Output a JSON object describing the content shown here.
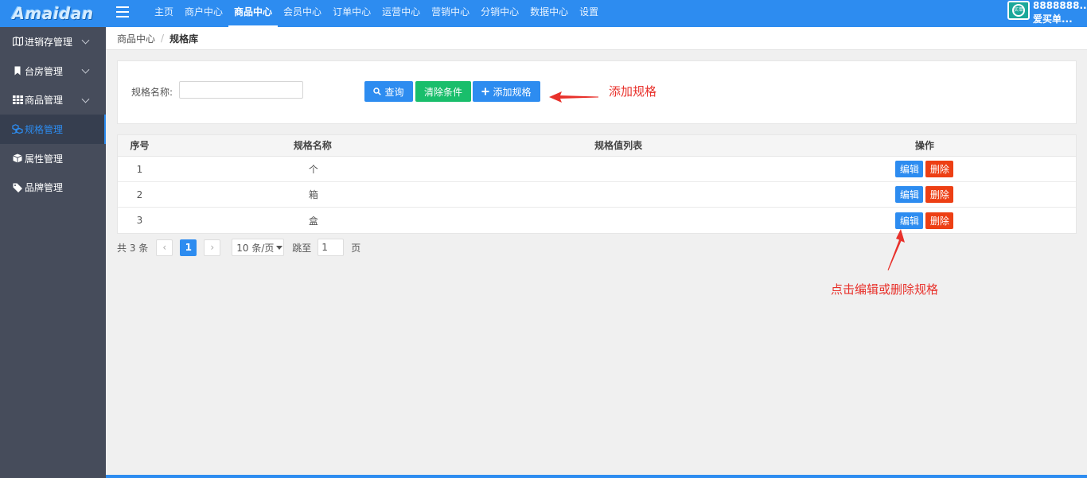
{
  "app": {
    "logo_text": "Amaidan"
  },
  "topnav": {
    "items": [
      {
        "label": "主页"
      },
      {
        "label": "商户中心"
      },
      {
        "label": "商品中心",
        "active": true
      },
      {
        "label": "会员中心"
      },
      {
        "label": "订单中心"
      },
      {
        "label": "运营中心"
      },
      {
        "label": "营销中心"
      },
      {
        "label": "分销中心"
      },
      {
        "label": "数据中心"
      },
      {
        "label": "设置"
      }
    ]
  },
  "user": {
    "id": "8888888...",
    "name": "爱买单...",
    "avatar_text": "买单"
  },
  "sidebar": {
    "items": [
      {
        "label": "进销存管理",
        "icon": "map-icon",
        "has_children": true
      },
      {
        "label": "台房管理",
        "icon": "bookmark-icon",
        "has_children": true
      },
      {
        "label": "商品管理",
        "icon": "grid-icon",
        "has_children": true
      },
      {
        "label": "规格管理",
        "icon": "cubes-icon",
        "active": true
      },
      {
        "label": "属性管理",
        "icon": "cube-icon"
      },
      {
        "label": "品牌管理",
        "icon": "tags-icon"
      }
    ]
  },
  "breadcrumb": {
    "first": "商品中心",
    "separator": "/",
    "current": "规格库"
  },
  "search": {
    "label": "规格名称:",
    "value": "",
    "placeholder": "",
    "query_button": "查询",
    "clear_button": "清除条件",
    "add_button": "添加规格"
  },
  "annotations": {
    "add": "添加规格",
    "edit": "点击编辑或删除规格",
    "color": "#e8312b"
  },
  "table": {
    "columns": [
      "序号",
      "规格名称",
      "规格值列表",
      "操作"
    ],
    "rows": [
      {
        "index": "1",
        "name": "个",
        "values": "",
        "edit": "编辑",
        "delete": "删除"
      },
      {
        "index": "2",
        "name": "箱",
        "values": "",
        "edit": "编辑",
        "delete": "删除"
      },
      {
        "index": "3",
        "name": "盒",
        "values": "",
        "edit": "编辑",
        "delete": "删除"
      }
    ]
  },
  "pagination": {
    "total_text": "共 3 条",
    "prev": "‹",
    "current_page": "1",
    "next": "›",
    "page_size": "10 条/页",
    "jump_label": "跳至",
    "jump_value": "1",
    "page_label": "页"
  },
  "colors": {
    "primary": "#2d8cf0",
    "success": "#19be6b",
    "danger": "#ed3f14",
    "sidebar": "#464c5b"
  }
}
